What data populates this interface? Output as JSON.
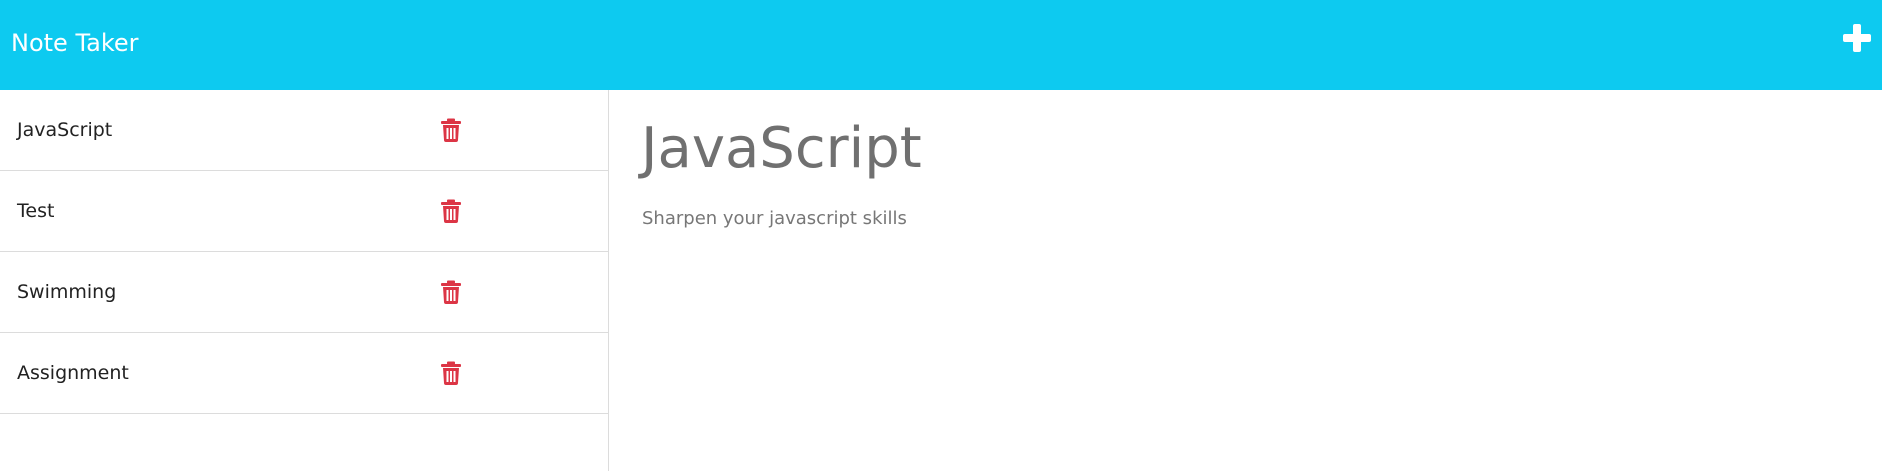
{
  "app": {
    "title": "Note Taker"
  },
  "icons": {
    "new_note": "plus-icon",
    "delete": "trash-icon"
  },
  "colors": {
    "navbar": "#0dcaf0",
    "delete": "#dc3545",
    "text": "#222222",
    "muted": "#707070"
  },
  "notes": [
    {
      "title": "JavaScript"
    },
    {
      "title": "Test"
    },
    {
      "title": "Swimming"
    },
    {
      "title": "Assignment"
    }
  ],
  "active_note": {
    "title": "JavaScript",
    "text": "Sharpen your javascript skills"
  }
}
